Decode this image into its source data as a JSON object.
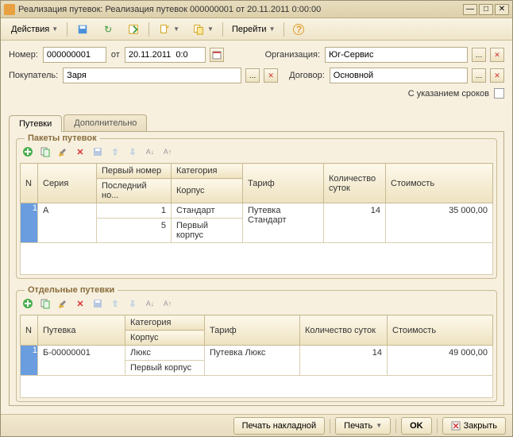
{
  "window_title": "Реализация путевок: Реализация путевок 000000001 от 20.11.2011 0:00:00",
  "toolbar": {
    "actions_label": "Действия",
    "goto_label": "Перейти"
  },
  "form": {
    "number_label": "Номер:",
    "number_value": "000000001",
    "from_label": "от",
    "date_value": "20.11.2011  0:0",
    "org_label": "Организация:",
    "org_value": "Юг-Сервис",
    "buyer_label": "Покупатель:",
    "buyer_value": "Заря",
    "contract_label": "Договор:",
    "contract_value": "Основной",
    "with_dates_label": "С указанием сроков"
  },
  "tabs": {
    "vouchers": "Путевки",
    "extra": "Дополнительно"
  },
  "packets": {
    "title": "Пакеты путевок",
    "head_n": "N",
    "head_series": "Серия",
    "head_firstnum": "Первый номер",
    "head_lastnum": "Последний но...",
    "head_category": "Категория",
    "head_korpus": "Корпус",
    "head_tarif": "Тариф",
    "head_days": "Количество суток",
    "head_cost": "Стоимость",
    "row1_n": "1",
    "row1_series": "А",
    "row1_firstnum": "1",
    "row1_lastnum": "5",
    "row1_category": "Стандарт",
    "row1_korpus": "Первый корпус",
    "row1_tarif": "Путевка Стандарт",
    "row1_days": "14",
    "row1_cost": "35 000,00"
  },
  "singles": {
    "title": "Отдельные путевки",
    "head_n": "N",
    "head_voucher": "Путевка",
    "head_category": "Категория",
    "head_korpus": "Корпус",
    "head_tarif": "Тариф",
    "head_days": "Количество суток",
    "head_cost": "Стоимость",
    "row1_n": "1",
    "row1_voucher": "Б-00000001",
    "row1_category": "Люкс",
    "row1_korpus": "Первый корпус",
    "row1_tarif": "Путевка Люкс",
    "row1_days": "14",
    "row1_cost": "49 000,00"
  },
  "footer": {
    "print_invoice": "Печать накладной",
    "print": "Печать",
    "ok": "OK",
    "close": "Закрыть"
  }
}
